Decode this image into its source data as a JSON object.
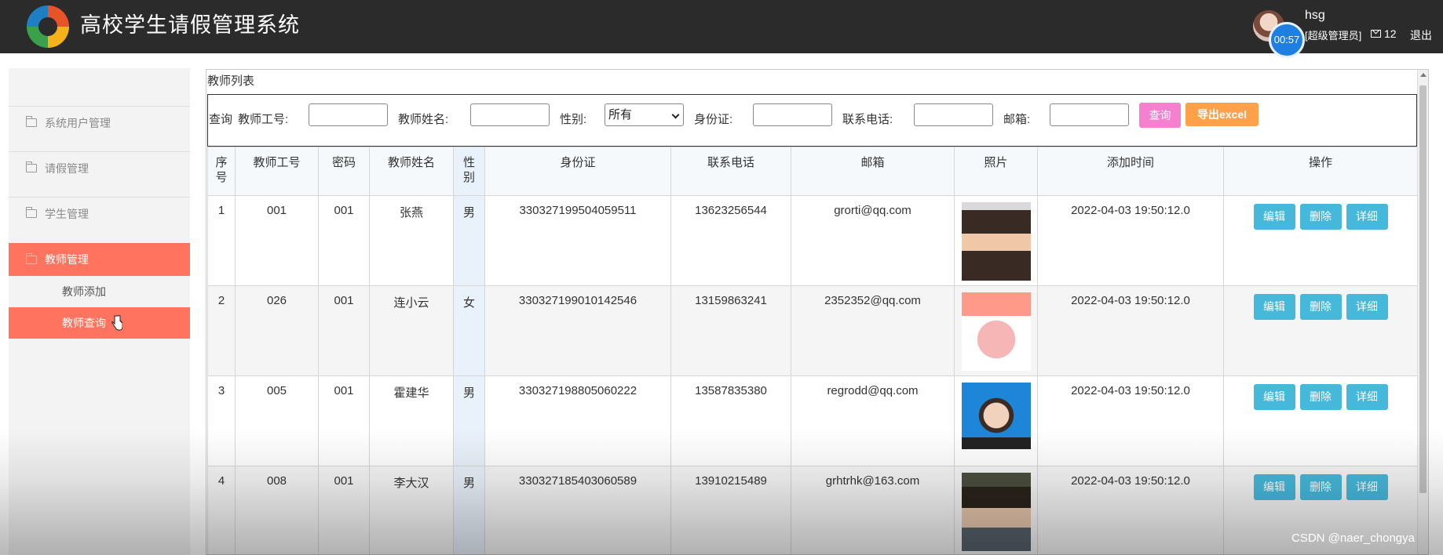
{
  "header": {
    "app_title": "高校学生请假管理系统",
    "user_name": "hsg",
    "user_role": "[超级管理员]",
    "message_count": "12",
    "logout_label": "退出",
    "timer": "00:57"
  },
  "sidebar": {
    "items": [
      {
        "label": "系统用户管理"
      },
      {
        "label": "请假管理"
      },
      {
        "label": "学生管理"
      },
      {
        "label": "教师管理"
      }
    ],
    "sub_items": [
      {
        "label": "教师添加"
      },
      {
        "label": "教师查询"
      }
    ]
  },
  "panel": {
    "title": "教师列表"
  },
  "search": {
    "prefix": "查询",
    "teacher_no_label": "教师工号:",
    "teacher_name_label": "教师姓名:",
    "gender_label": "性别:",
    "gender_value": "所有",
    "id_card_label": "身份证:",
    "phone_label": "联系电话:",
    "email_label": "邮箱:",
    "query_button": "查询",
    "export_button": "导出excel"
  },
  "table": {
    "headers": [
      "序号",
      "教师工号",
      "密码",
      "教师姓名",
      "性别",
      "身份证",
      "联系电话",
      "邮箱",
      "照片",
      "添加时间",
      "操作"
    ],
    "rows": [
      {
        "index": "1",
        "no": "001",
        "password": "001",
        "name": "张燕",
        "gender": "男",
        "id_card": "330327199504059511",
        "phone": "13623256544",
        "email": "grorti@qq.com",
        "added": "2022-04-03 19:50:12.0"
      },
      {
        "index": "2",
        "no": "026",
        "password": "001",
        "name": "连小云",
        "gender": "女",
        "id_card": "330327199010142546",
        "phone": "13159863241",
        "email": "2352352@qq.com",
        "added": "2022-04-03 19:50:12.0"
      },
      {
        "index": "3",
        "no": "005",
        "password": "001",
        "name": "霍建华",
        "gender": "男",
        "id_card": "330327198805060222",
        "phone": "13587835380",
        "email": "regrodd@qq.com",
        "added": "2022-04-03 19:50:12.0"
      },
      {
        "index": "4",
        "no": "008",
        "password": "001",
        "name": "李大汉",
        "gender": "男",
        "id_card": "330327185403060589",
        "phone": "13910215489",
        "email": "grhtrhk@163.com",
        "added": "2022-04-03 19:50:12.0"
      }
    ],
    "actions": {
      "edit": "编辑",
      "delete": "删除",
      "detail": "详细"
    }
  },
  "watermark": "CSDN @naer_chongya"
}
